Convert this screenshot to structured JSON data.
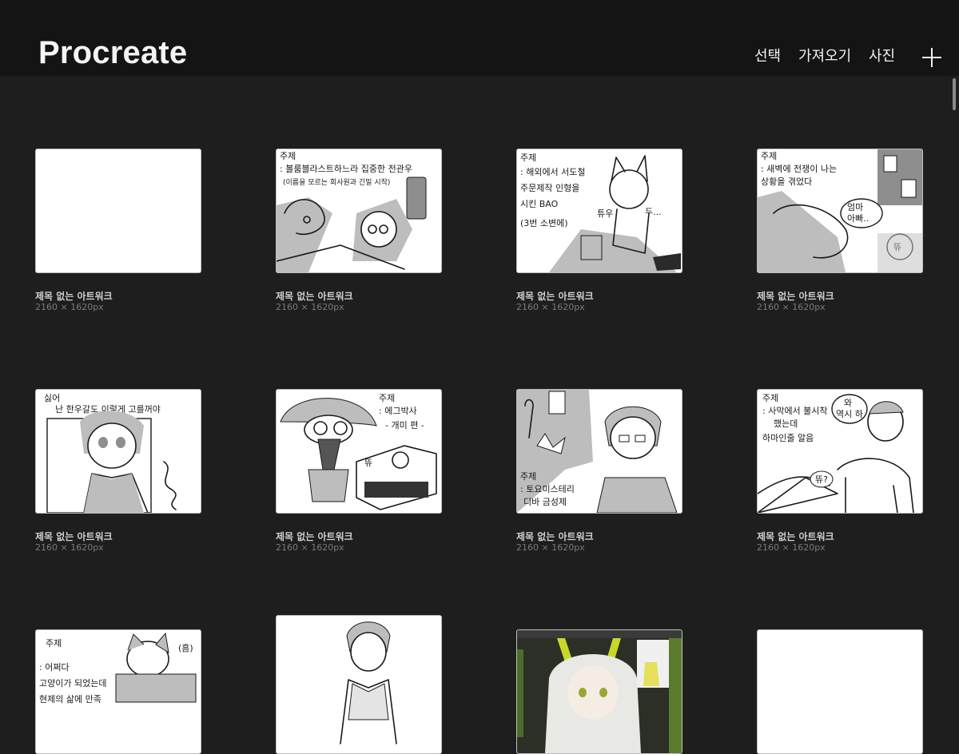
{
  "header": {
    "title": "Procreate",
    "select_label": "선택",
    "import_label": "가져오기",
    "photo_label": "사진",
    "new_icon": "plus-icon"
  },
  "gallery": {
    "items": [
      {
        "title": "제목 없는 아트워크",
        "size": "2160 × 1620px"
      },
      {
        "title": "제목 없는 아트워크",
        "size": "2160 × 1620px"
      },
      {
        "title": "제목 없는 아트워크",
        "size": "2160 × 1620px"
      },
      {
        "title": "제목 없는 아트워크",
        "size": "2160 × 1620px"
      },
      {
        "title": "제목 없는 아트워크",
        "size": "2160 × 1620px"
      },
      {
        "title": "제목 없는 아트워크",
        "size": "2160 × 1620px"
      },
      {
        "title": "제목 없는 아트워크",
        "size": "2160 × 1620px"
      },
      {
        "title": "제목 없는 아트워크",
        "size": "2160 × 1620px"
      },
      {
        "title": "",
        "size": ""
      },
      {
        "title": "",
        "size": ""
      },
      {
        "title": "",
        "size": ""
      },
      {
        "title": "",
        "size": ""
      }
    ],
    "sketch_text": {
      "t2": [
        "주제",
        ": 볼룸블라스트하느라 집중한 전관우",
        "(이름을 모르는 회사원과 긴밀 시작)"
      ],
      "t3": [
        "주제",
        ": 해외에서 서도철",
        "주문제작 인형을",
        "시킨 BAO",
        "(3번 소변에)",
        "튜우",
        "두..."
      ],
      "t4": [
        "주제",
        ": 새벽에 전쟁이 나는",
        "상황을 겪었다",
        "엄마",
        "아빠..",
        "뜌"
      ],
      "t5": [
        "싫어",
        "난 한우갈도 이렇게 고를꺼야"
      ],
      "t6": [
        "주제",
        ": 에그박사",
        "- 개미 편 -",
        "뜌"
      ],
      "t7": [
        "주제",
        ": 토요미스테리",
        "디바 금성제"
      ],
      "t8": [
        "주제",
        ": 사막에서 불시착",
        "했는데",
        "하마인줄 알음",
        "와",
        "역시 하",
        "뜌?"
      ],
      "t9": [
        "주제",
        ": 어쩌다",
        "고양이가 되었는데",
        "현제의 삶에 만족",
        "(흠)"
      ]
    }
  }
}
